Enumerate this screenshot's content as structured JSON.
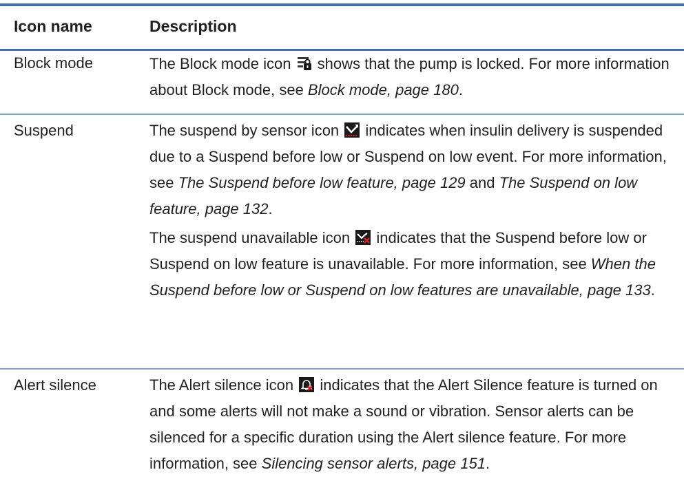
{
  "table": {
    "headers": [
      "Icon name",
      "Description"
    ],
    "rows": [
      {
        "name": "Block mode",
        "paragraphs": [
          {
            "parts": [
              {
                "text": "The Block mode icon ",
                "style": "normal"
              },
              {
                "icon": "block-mode-lock-icon"
              },
              {
                "text": " shows that the pump is locked. For more information about Block mode, see ",
                "style": "normal"
              },
              {
                "text": "Block mode, page 180",
                "style": "italic"
              },
              {
                "text": ".",
                "style": "normal"
              }
            ]
          }
        ]
      },
      {
        "name": "Suspend",
        "paragraphs": [
          {
            "parts": [
              {
                "text": "The suspend by sensor icon ",
                "style": "normal"
              },
              {
                "icon": "suspend-by-sensor-icon"
              },
              {
                "text": " indicates when insulin delivery is suspended due to a Suspend before low or Suspend on low event. For more information, see ",
                "style": "normal"
              },
              {
                "text": "The Suspend before low feature, page 129",
                "style": "italic"
              },
              {
                "text": " and ",
                "style": "normal"
              },
              {
                "text": "The Suspend on low feature, page 132",
                "style": "italic"
              },
              {
                "text": ".",
                "style": "normal"
              }
            ]
          },
          {
            "parts": [
              {
                "text": "The suspend unavailable icon ",
                "style": "normal"
              },
              {
                "icon": "suspend-unavailable-icon"
              },
              {
                "text": " indicates that the Suspend before low or Suspend on low feature is unavailable. For more information, see ",
                "style": "normal"
              },
              {
                "text": "When the Suspend before low or Suspend on low features are unavailable, page 133",
                "style": "italic"
              },
              {
                "text": ".",
                "style": "normal"
              }
            ]
          }
        ]
      },
      {
        "name": "Alert silence",
        "paragraphs": [
          {
            "parts": [
              {
                "text": "The Alert silence icon ",
                "style": "normal"
              },
              {
                "icon": "alert-silence-bell-icon"
              },
              {
                "text": " indicates that the Alert Silence feature is turned on and some alerts will not make a sound or vibration. Sensor alerts can be silenced for a specific duration using the Alert silence feature. For more information, see ",
                "style": "normal"
              },
              {
                "text": "Silencing sensor alerts, page 151",
                "style": "italic"
              },
              {
                "text": ".",
                "style": "normal"
              }
            ]
          }
        ]
      }
    ]
  },
  "colors": {
    "rule": "#3d6ea8",
    "row_rule": "#7ea0c9",
    "text": "#231f20",
    "icon_bg": "#1a1a1a",
    "icon_red": "#d6242a"
  }
}
